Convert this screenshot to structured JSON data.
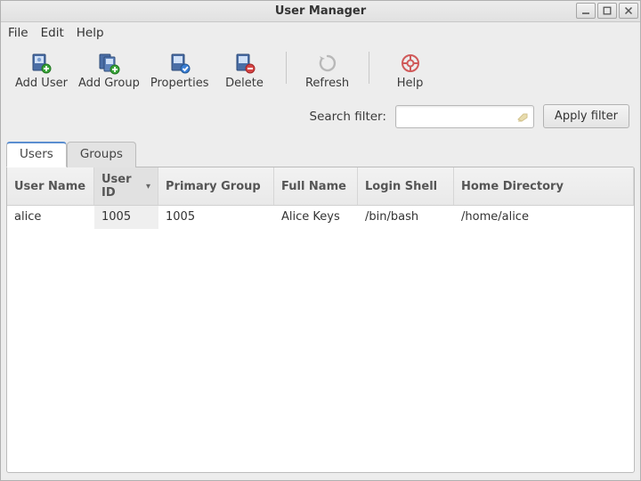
{
  "window": {
    "title": "User Manager"
  },
  "menubar": {
    "file": "File",
    "edit": "Edit",
    "help": "Help"
  },
  "toolbar": {
    "add_user": "Add User",
    "add_group": "Add Group",
    "properties": "Properties",
    "delete": "Delete",
    "refresh": "Refresh",
    "help": "Help"
  },
  "search": {
    "label": "Search filter:",
    "value": "",
    "apply": "Apply filter"
  },
  "tabs": {
    "users": "Users",
    "groups": "Groups",
    "active": "users"
  },
  "columns": {
    "user_name": "User Name",
    "user_id": "User ID",
    "primary_group": "Primary Group",
    "full_name": "Full Name",
    "login_shell": "Login Shell",
    "home_dir": "Home Directory",
    "sorted_by": "user_id",
    "sort_dir": "desc"
  },
  "rows": [
    {
      "user_name": "alice",
      "user_id": "1005",
      "primary_group": "1005",
      "full_name": "Alice Keys",
      "login_shell": "/bin/bash",
      "home_dir": "/home/alice"
    }
  ]
}
